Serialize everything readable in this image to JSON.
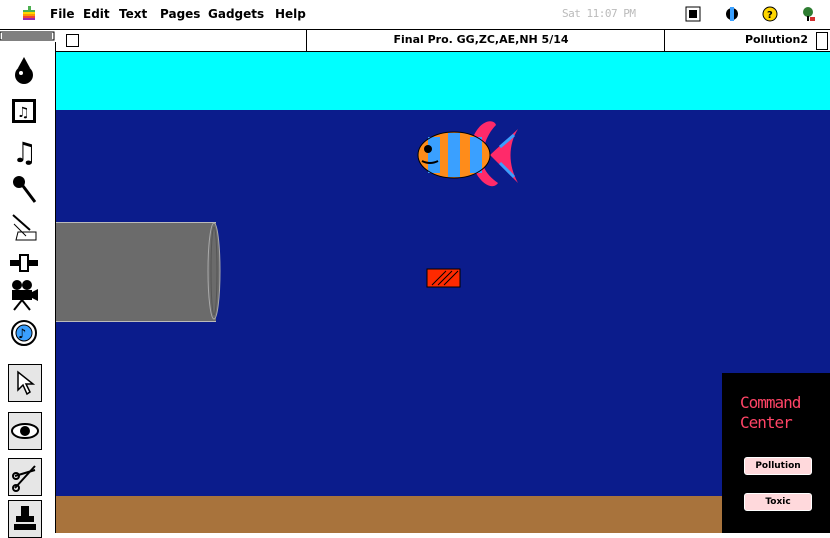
{
  "menubar": {
    "items": [
      "File",
      "Edit",
      "Text",
      "Pages",
      "Gadgets",
      "Help"
    ],
    "clock": "Sat 11:07 PM"
  },
  "window": {
    "title": "Final Pro. GG,ZC,AE,NH 5/14",
    "page_name": "Pollution2"
  },
  "command_center": {
    "title_line1": "Command",
    "title_line2": "Center",
    "buttons": [
      "Pollution",
      "Toxic"
    ]
  },
  "colors": {
    "sky": "#00ffff",
    "water": "#0b1c8c",
    "sand": "#a8733c",
    "pipe": "#6b6b6b",
    "can": "#ff2a00",
    "fish_orange": "#ff8c1a",
    "fish_blue": "#3aa0ff",
    "fish_pink": "#ff2a6a",
    "panel_text": "#ff4466"
  },
  "tools": [
    "wizard-icon",
    "chord-icon",
    "music-note-icon",
    "microphone-icon",
    "drafting-icon",
    "slider-icon",
    "movie-camera-icon",
    "cd-icon",
    "pointer-icon",
    "eye-icon",
    "scissors-icon",
    "stamp-icon"
  ]
}
